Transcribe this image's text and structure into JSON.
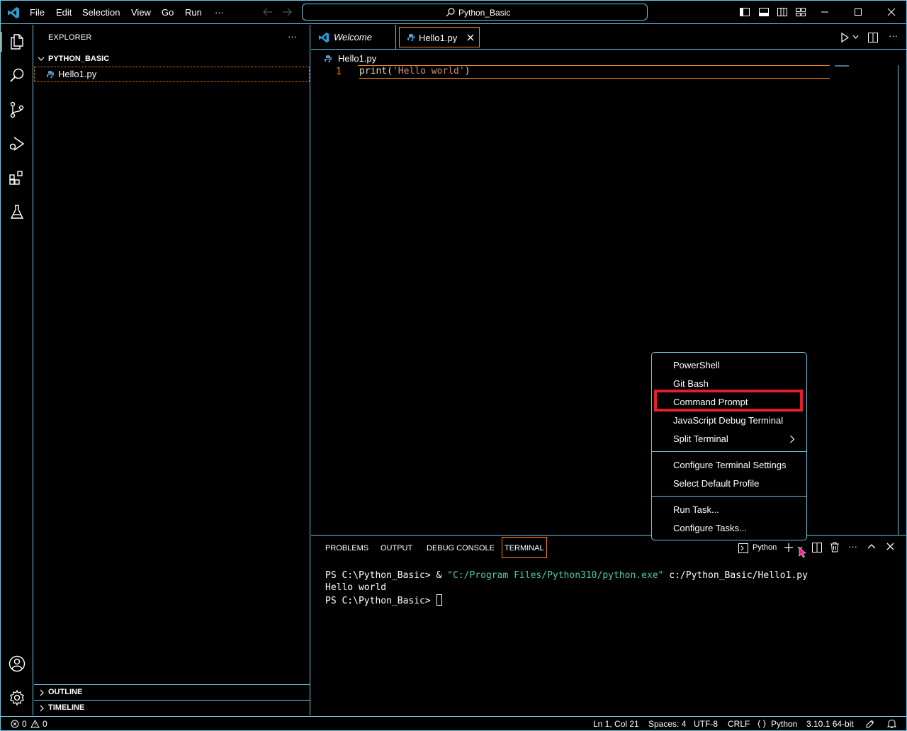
{
  "titlebar": {
    "menus": [
      "File",
      "Edit",
      "Selection",
      "View",
      "Go",
      "Run",
      "···"
    ],
    "search_label": "Python_Basic"
  },
  "sidebar": {
    "header": "EXPLORER",
    "more": "···",
    "folder": "PYTHON_BASIC",
    "file": "Hello1.py",
    "outline": "OUTLINE",
    "timeline": "TIMELINE"
  },
  "editor": {
    "tabs": [
      {
        "label": "Welcome"
      },
      {
        "label": "Hello1.py"
      }
    ],
    "breadcrumb": "Hello1.py",
    "line_number": "1",
    "code": {
      "fn": "print(",
      "str": "'Hello world'",
      "close": ")"
    }
  },
  "panel": {
    "tabs": [
      "PROBLEMS",
      "OUTPUT",
      "DEBUG CONSOLE",
      "TERMINAL"
    ],
    "terminal_name": "Python",
    "lines": {
      "l1_prompt": "PS C:\\Python_Basic> & ",
      "l1_path": "\"C:/Program Files/Python310/python.exe\"",
      "l1_arg": " c:/Python_Basic/Hello1.py",
      "l2": "Hello world",
      "l3": "PS C:\\Python_Basic> "
    }
  },
  "dropdown": {
    "items": [
      "PowerShell",
      "Git Bash",
      "Command Prompt",
      "JavaScript Debug Terminal",
      "Split Terminal"
    ],
    "items2": [
      "Configure Terminal Settings",
      "Select Default Profile"
    ],
    "items3": [
      "Run Task...",
      "Configure Tasks..."
    ]
  },
  "statusbar": {
    "errors": "0",
    "warnings": "0",
    "position": "Ln 1, Col 21",
    "spaces": "Spaces: 4",
    "encoding": "UTF-8",
    "eol": "CRLF",
    "language": "Python",
    "interpreter": "3.10.1 64-bit"
  },
  "colors": {
    "border": "#6fc3df",
    "focus": "#f38518",
    "highlight": "#e0202a",
    "vscode_blue": "#2f9bd8"
  }
}
